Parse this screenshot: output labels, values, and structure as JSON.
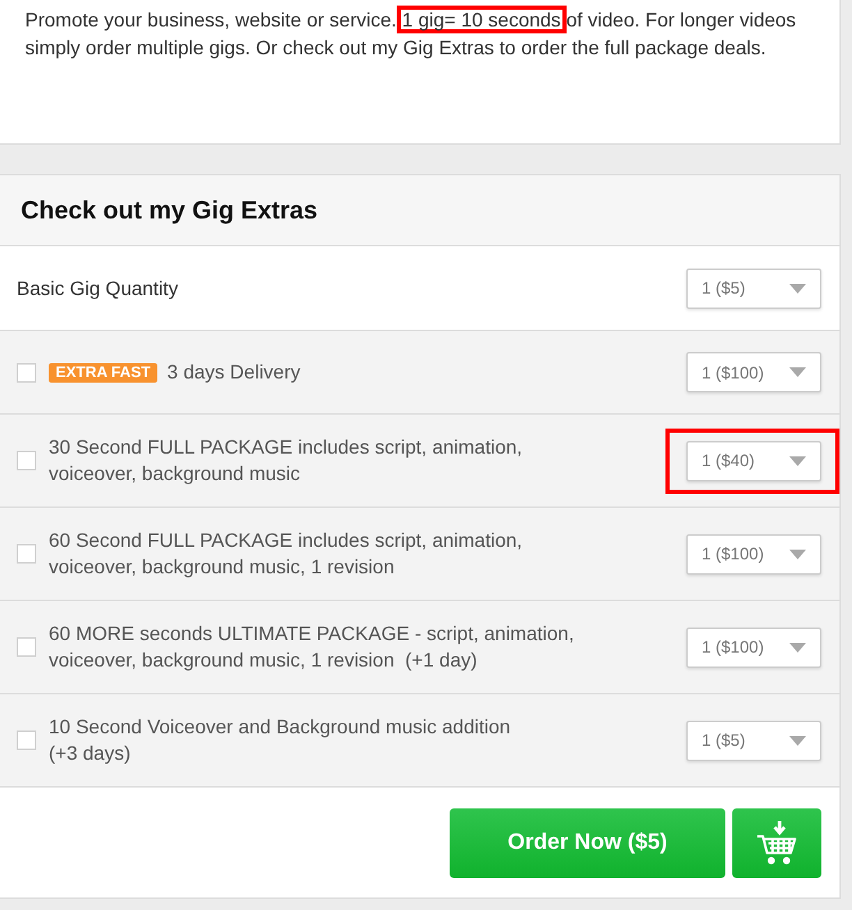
{
  "intro": {
    "segments": [
      {
        "text": "Promote your business, website or service.",
        "highlighted": false
      },
      {
        "text": "1 gig= 10 seconds",
        "highlighted": true
      },
      {
        "text": "of video. For longer videos simply order multiple gigs. Or check out my Gig Extras to order the full package deals.",
        "highlighted": false
      }
    ]
  },
  "extras_panel": {
    "title": "Check out my Gig Extras",
    "base": {
      "label": "Basic Gig Quantity",
      "quantity": "1 ($5)"
    },
    "extras": [
      {
        "checked": false,
        "badge": "EXTRA FAST",
        "label": "3 days Delivery",
        "quantity": "1 ($100)",
        "highlighted": false
      },
      {
        "checked": false,
        "label": "30 Second FULL PACKAGE includes script, animation, voiceover, background music",
        "quantity": "1 ($40)",
        "highlighted": true
      },
      {
        "checked": false,
        "label": "60 Second FULL PACKAGE includes script, animation, voiceover, background music, 1 revision",
        "quantity": "1 ($100)",
        "highlighted": false
      },
      {
        "checked": false,
        "label": "60 MORE seconds ULTIMATE PACKAGE - script, animation, voiceover, background music, 1 revision  (+1 day)",
        "quantity": "1 ($100)",
        "highlighted": false
      },
      {
        "checked": false,
        "label": "10 Second Voiceover and Background music addition\n(+3 days)",
        "quantity": "1 ($5)",
        "highlighted": false
      }
    ],
    "order_button": "Order Now ($5)"
  }
}
